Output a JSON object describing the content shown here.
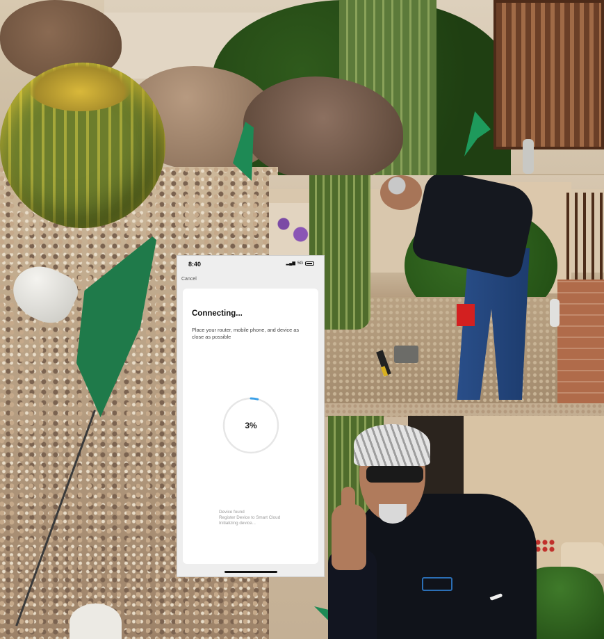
{
  "phone": {
    "status_time": "8:40",
    "status_network": "5G",
    "cancel_label": "Cancel",
    "title": "Connecting...",
    "description": "Place your router, mobile phone, and device as close as possible",
    "progress_percent": 3,
    "progress_label": "3%",
    "progress_color": "#3aa0e8",
    "log_lines": [
      "Device found",
      "Register Device to Smart Cloud",
      "Initializing device..."
    ]
  }
}
